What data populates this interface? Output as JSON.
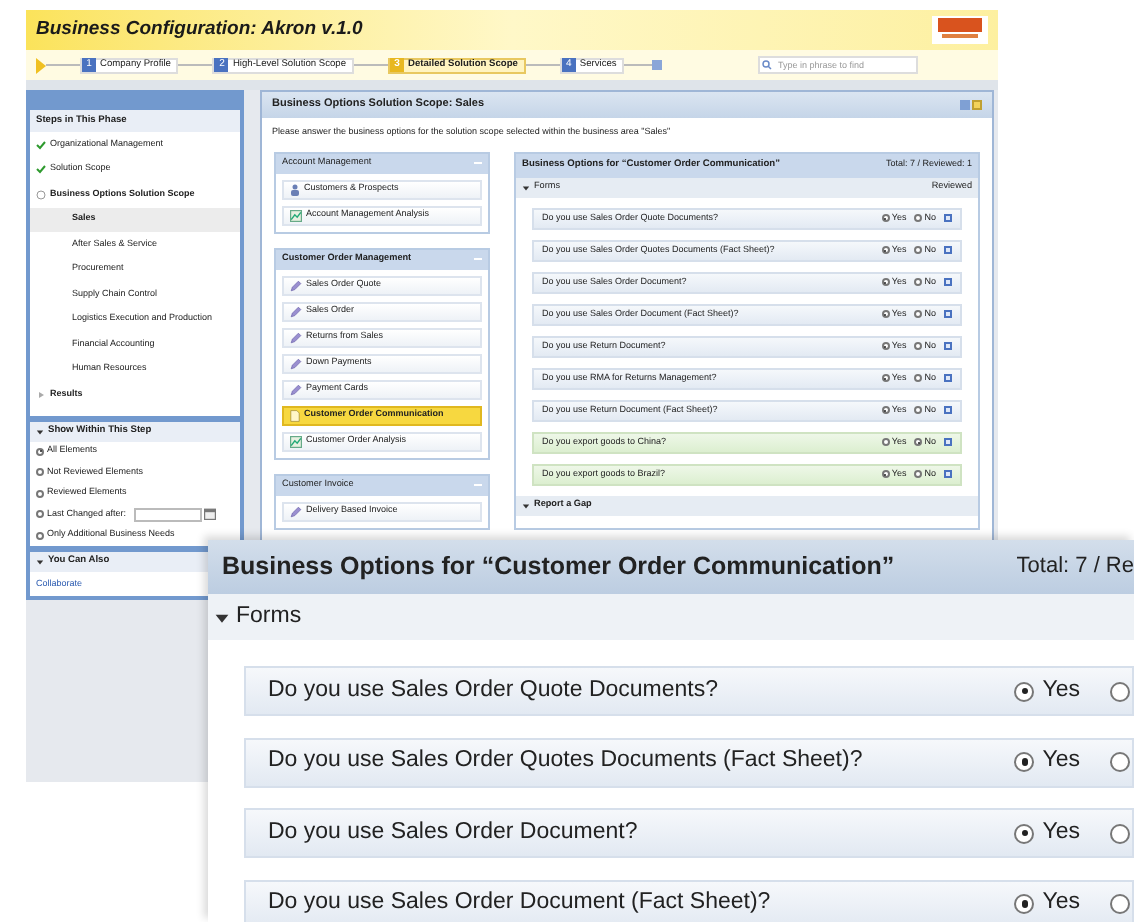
{
  "window": {
    "title": "Business Configuration: Akron v.1.0"
  },
  "steps": [
    {
      "number": "1",
      "label": "Company Profile",
      "selected": false
    },
    {
      "number": "2",
      "label": "High-Level Solution Scope",
      "selected": false
    },
    {
      "number": "3",
      "label": "Detailed Solution Scope",
      "selected": true
    },
    {
      "number": "4",
      "label": "Services",
      "selected": false
    }
  ],
  "search": {
    "placeholder": "Type in phrase to find"
  },
  "sidebar": {
    "steps_panel": {
      "title": "Steps in This Phase",
      "items": [
        {
          "label": "Organizational Management",
          "kind": "done"
        },
        {
          "label": "Solution Scope",
          "kind": "done"
        },
        {
          "label": "Business Options Solution Scope",
          "kind": "current",
          "children": [
            {
              "label": "Sales",
              "selected": true
            },
            {
              "label": "After Sales & Service",
              "selected": false
            },
            {
              "label": "Procurement",
              "selected": false
            },
            {
              "label": "Supply Chain Control",
              "selected": false
            },
            {
              "label": "Logistics Execution and Production",
              "selected": false
            },
            {
              "label": "Financial Accounting",
              "selected": false
            },
            {
              "label": "Human Resources",
              "selected": false
            }
          ]
        },
        {
          "label": "Results",
          "kind": "pending"
        }
      ]
    },
    "show_panel": {
      "title": "Show Within This Step",
      "expanded": true,
      "options": [
        {
          "label": "All Elements",
          "selected": true,
          "kind": "plain"
        },
        {
          "label": "Not Reviewed Elements",
          "selected": false,
          "kind": "plain"
        },
        {
          "label": "Reviewed Elements",
          "selected": false,
          "kind": "plain"
        },
        {
          "label": "Last Changed after:",
          "selected": false,
          "kind": "date"
        },
        {
          "label": "Only Additional Business Needs",
          "selected": false,
          "kind": "plain"
        }
      ]
    },
    "also_panel": {
      "title": "You Can Also",
      "expanded": true,
      "links": [
        "Collaborate"
      ]
    }
  },
  "main": {
    "title": "Business Options Solution Scope: Sales",
    "instructions": "Please answer the business options for the solution scope selected within the business area \"Sales\"",
    "groups": [
      {
        "title": "Account Management",
        "active": false,
        "items": [
          {
            "label": "Customers & Prospects",
            "kind": "person",
            "selected": false
          },
          {
            "label": "Account Management Analysis",
            "kind": "chart",
            "selected": false
          }
        ]
      },
      {
        "title": "Customer Order Management",
        "active": true,
        "items": [
          {
            "label": "Sales Order Quote",
            "kind": "pencil",
            "selected": false
          },
          {
            "label": "Sales Order",
            "kind": "pencil",
            "selected": false
          },
          {
            "label": "Returns from Sales",
            "kind": "pencil",
            "selected": false
          },
          {
            "label": "Down Payments",
            "kind": "pencil",
            "selected": false
          },
          {
            "label": "Payment Cards",
            "kind": "pencil",
            "selected": false
          },
          {
            "label": "Customer Order Communication",
            "kind": "document",
            "selected": true
          },
          {
            "label": "Customer Order Analysis",
            "kind": "chart",
            "selected": false
          }
        ]
      },
      {
        "title": "Customer Invoice",
        "active": false,
        "items": [
          {
            "label": "Delivery Based Invoice",
            "kind": "pencil",
            "selected": false
          }
        ]
      }
    ],
    "options_panel": {
      "title": "Business Options for “Customer Order Communication”",
      "total": "Total: 7 / Reviewed: 1",
      "sections": [
        {
          "title": "Forms",
          "expanded": true,
          "column": "Reviewed",
          "questions": [
            {
              "text": "Do you use Sales Order Quote Documents?",
              "kind": "standard",
              "options": [
                {
                  "label": "Yes",
                  "selected": true
                },
                {
                  "label": "No",
                  "selected": false
                }
              ]
            },
            {
              "text": "Do you use Sales Order Quotes Documents (Fact Sheet)?",
              "kind": "standard",
              "options": [
                {
                  "label": "Yes",
                  "selected": true
                },
                {
                  "label": "No",
                  "selected": false
                }
              ]
            },
            {
              "text": "Do you use Sales Order Document?",
              "kind": "standard",
              "options": [
                {
                  "label": "Yes",
                  "selected": true
                },
                {
                  "label": "No",
                  "selected": false
                }
              ]
            },
            {
              "text": "Do you use Sales Order Document (Fact Sheet)?",
              "kind": "standard",
              "options": [
                {
                  "label": "Yes",
                  "selected": true
                },
                {
                  "label": "No",
                  "selected": false
                }
              ]
            },
            {
              "text": "Do you use Return Document?",
              "kind": "standard",
              "options": [
                {
                  "label": "Yes",
                  "selected": true
                },
                {
                  "label": "No",
                  "selected": false
                }
              ]
            },
            {
              "text": "Do you use RMA for Returns Management?",
              "kind": "standard",
              "options": [
                {
                  "label": "Yes",
                  "selected": true
                },
                {
                  "label": "No",
                  "selected": false
                }
              ]
            },
            {
              "text": "Do you use Return Document (Fact Sheet)?",
              "kind": "standard",
              "options": [
                {
                  "label": "Yes",
                  "selected": true
                },
                {
                  "label": "No",
                  "selected": false
                }
              ]
            },
            {
              "text": "Do you export goods to China?",
              "kind": "additional",
              "options": [
                {
                  "label": "Yes",
                  "selected": false
                },
                {
                  "label": "No",
                  "selected": true
                }
              ]
            },
            {
              "text": "Do you export goods to Brazil?",
              "kind": "additional",
              "options": [
                {
                  "label": "Yes",
                  "selected": true
                },
                {
                  "label": "No",
                  "selected": false
                }
              ]
            }
          ]
        },
        {
          "title": "Report a Gap",
          "expanded": true
        }
      ]
    }
  },
  "callout": {
    "title": "Business Options for “Customer Order Communication”",
    "total": "Total: 7 / Re",
    "section": {
      "title": "Forms",
      "expanded": true
    },
    "questions": [
      {
        "text": "Do you use Sales Order Quote Documents?",
        "options": [
          {
            "label": "Yes",
            "selected": true
          },
          {
            "selected": false
          }
        ]
      },
      {
        "text": "Do you use Sales Order Quotes Documents (Fact Sheet)?",
        "options": [
          {
            "label": "Yes",
            "selected": true
          },
          {
            "selected": false
          }
        ]
      },
      {
        "text": "Do you use Sales Order Document?",
        "options": [
          {
            "label": "Yes",
            "selected": true
          },
          {
            "selected": false
          }
        ]
      },
      {
        "text": "Do you use Sales Order Document (Fact Sheet)?",
        "options": [
          {
            "label": "Yes",
            "selected": true
          },
          {
            "selected": false
          }
        ]
      }
    ]
  }
}
